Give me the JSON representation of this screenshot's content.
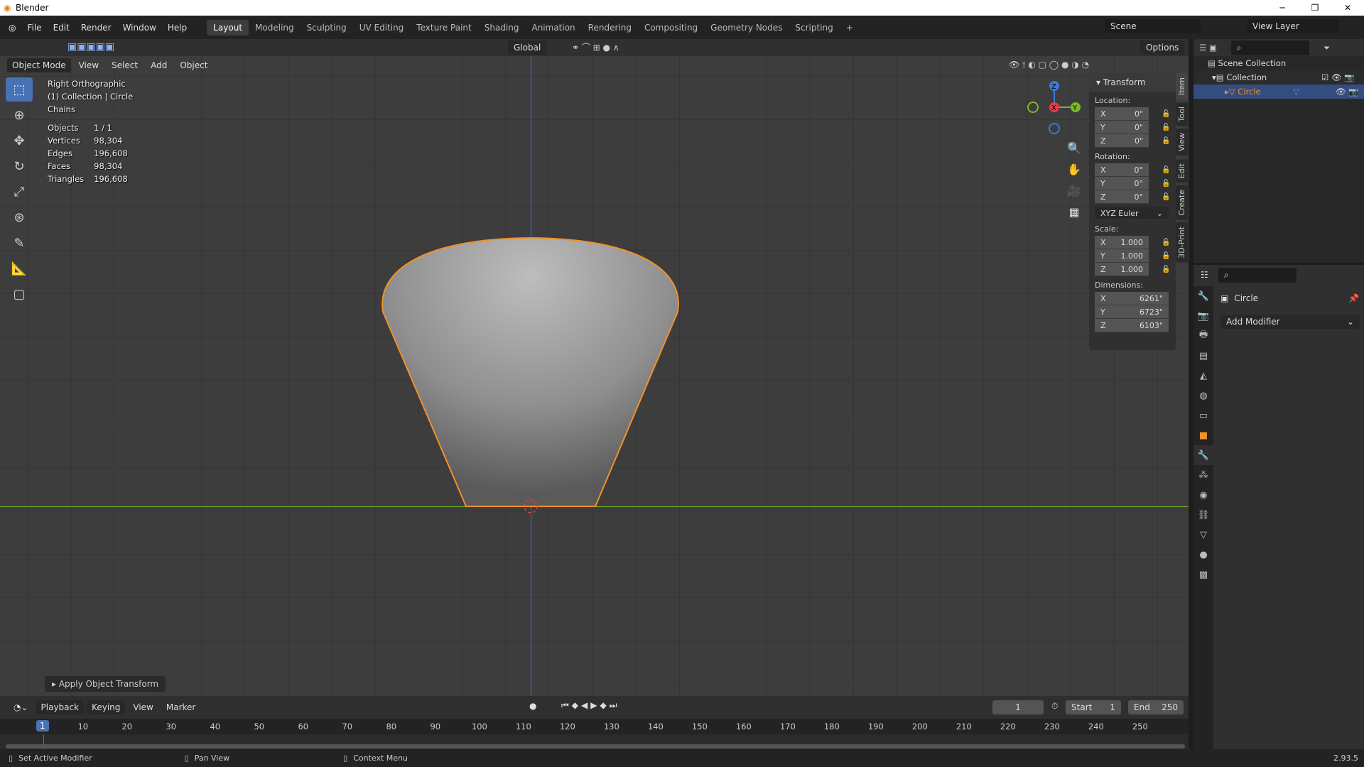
{
  "window": {
    "title": "Blender",
    "minimize": "─",
    "restore": "❐",
    "close": "✕"
  },
  "menus": [
    "File",
    "Edit",
    "Render",
    "Window",
    "Help"
  ],
  "workspaces": [
    "Layout",
    "Modeling",
    "Sculpting",
    "UV Editing",
    "Texture Paint",
    "Shading",
    "Animation",
    "Rendering",
    "Compositing",
    "Geometry Nodes",
    "Scripting",
    "+"
  ],
  "active_workspace": "Layout",
  "scene": "Scene",
  "view_layer": "View Layer",
  "toolheader": {
    "orientation": "Global",
    "options": "Options"
  },
  "viewport_header": {
    "mode": "Object Mode",
    "menus": [
      "View",
      "Select",
      "Add",
      "Object"
    ]
  },
  "overlay": {
    "view": "Right Orthographic",
    "collection": "(1) Collection | Circle",
    "chains": "Chains",
    "stats": [
      [
        "Objects",
        "1 / 1"
      ],
      [
        "Vertices",
        "98,304"
      ],
      [
        "Edges",
        "196,608"
      ],
      [
        "Faces",
        "98,304"
      ],
      [
        "Triangles",
        "196,608"
      ]
    ]
  },
  "gizmo": {
    "z": "Z",
    "y": "Y",
    "x": "X"
  },
  "transform": {
    "title": "Transform",
    "location_label": "Location:",
    "location": [
      [
        "X",
        "0\""
      ],
      [
        "Y",
        "0\""
      ],
      [
        "Z",
        "0\""
      ]
    ],
    "rotation_label": "Rotation:",
    "rotation": [
      [
        "X",
        "0°"
      ],
      [
        "Y",
        "0°"
      ],
      [
        "Z",
        "0°"
      ]
    ],
    "rotation_mode": "XYZ Euler",
    "scale_label": "Scale:",
    "scale": [
      [
        "X",
        "1.000"
      ],
      [
        "Y",
        "1.000"
      ],
      [
        "Z",
        "1.000"
      ]
    ],
    "dimensions_label": "Dimensions:",
    "dimensions": [
      [
        "X",
        "6261\""
      ],
      [
        "Y",
        "6723\""
      ],
      [
        "Z",
        "6103\""
      ]
    ]
  },
  "ntabs": [
    "Item",
    "Tool",
    "View",
    "Edit",
    "Create",
    "3D-Print"
  ],
  "outliner": {
    "root": "Scene Collection",
    "collection": "Collection",
    "object": "Circle"
  },
  "properties": {
    "object": "Circle",
    "add_modifier": "Add Modifier"
  },
  "last_op": "Apply Object Transform",
  "timeline": {
    "menus": [
      "Playback",
      "Keying",
      "View",
      "Marker"
    ],
    "current_frame": "1",
    "start_label": "Start",
    "start": "1",
    "end_label": "End",
    "end": "250",
    "ticks": [
      "10",
      "20",
      "30",
      "40",
      "50",
      "60",
      "70",
      "80",
      "90",
      "100",
      "110",
      "120",
      "130",
      "140",
      "150",
      "160",
      "170",
      "180",
      "190",
      "200",
      "210",
      "220",
      "230",
      "240",
      "250"
    ]
  },
  "status": {
    "left": "Set Active Modifier",
    "middle": "Pan View",
    "right": "Context Menu",
    "version": "2.93.5"
  },
  "colors": {
    "accent": "#4772b3",
    "selection": "#f0912a",
    "x_axis": "#e8394b",
    "y_axis": "#7ab82a",
    "z_axis": "#3d7ad8"
  }
}
